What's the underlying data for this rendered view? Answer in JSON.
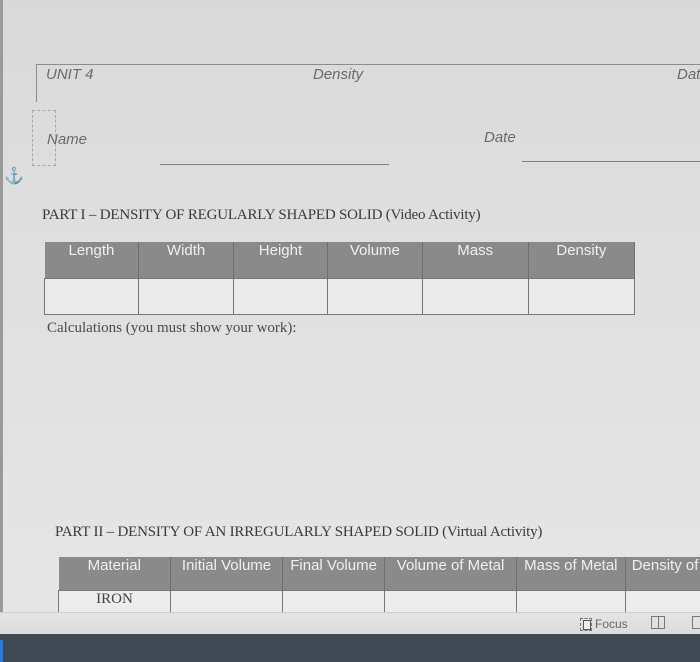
{
  "header": {
    "unit": "UNIT 4",
    "topic": "Density",
    "date_truncated": "Dat"
  },
  "student_info": {
    "name_label": "Name",
    "date_label": "Date",
    "name_value": "",
    "date_value": ""
  },
  "part1": {
    "title": "PART I – DENSITY OF REGULARLY SHAPED SOLID (Video Activity)",
    "columns": [
      "Length",
      "Width",
      "Height",
      "Volume",
      "Mass",
      "Density"
    ],
    "rows": [
      [
        "",
        "",
        "",
        "",
        "",
        ""
      ]
    ],
    "calculations_label": "Calculations (you must show your work):"
  },
  "part2": {
    "title": "PART II – DENSITY OF AN IRREGULARLY SHAPED SOLID (Virtual Activity)",
    "columns": [
      "Material",
      "Initial Volume",
      "Final Volume",
      "Volume of Metal",
      "Mass of Metal",
      "Density of"
    ],
    "rows": [
      [
        "IRON",
        "",
        "",
        "",
        "",
        ""
      ]
    ]
  },
  "status_bar": {
    "focus_label": "Focus",
    "icons": [
      "focus-icon",
      "read-mode-icon",
      "print-layout-icon"
    ]
  },
  "icons": {
    "anchor": "⚓"
  }
}
